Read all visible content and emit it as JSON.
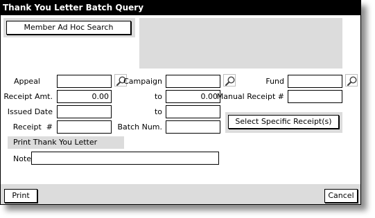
{
  "window": {
    "title": "Thank You Letter Batch Query"
  },
  "buttons": {
    "member_search": "Member Ad Hoc Search",
    "select_receipts": "Select Specific Receipt(s)",
    "print": "Print",
    "cancel": "Cancel"
  },
  "fields": {
    "appeal": {
      "label": "Appeal",
      "value": ""
    },
    "campaign": {
      "label": "Campaign",
      "value": ""
    },
    "fund": {
      "label": "Fund",
      "value": ""
    },
    "receipt_amt": {
      "label": "Receipt Amt.",
      "value": "0.00"
    },
    "receipt_amt_to": {
      "label": "to",
      "value": "0.00"
    },
    "manual_receipt": {
      "label": "Manual Receipt #",
      "value": ""
    },
    "issued_date": {
      "label": "Issued Date",
      "value": ""
    },
    "issued_date_to": {
      "label": "to",
      "value": ""
    },
    "receipt_no": {
      "label": "Receipt  #",
      "value": ""
    },
    "batch_num": {
      "label": "Batch Num.",
      "value": ""
    },
    "note": {
      "label": "Note",
      "value": ""
    }
  },
  "section": {
    "print_letter": "Print Thank You Letter"
  },
  "icons": {
    "lookup": "magnifier-icon"
  }
}
